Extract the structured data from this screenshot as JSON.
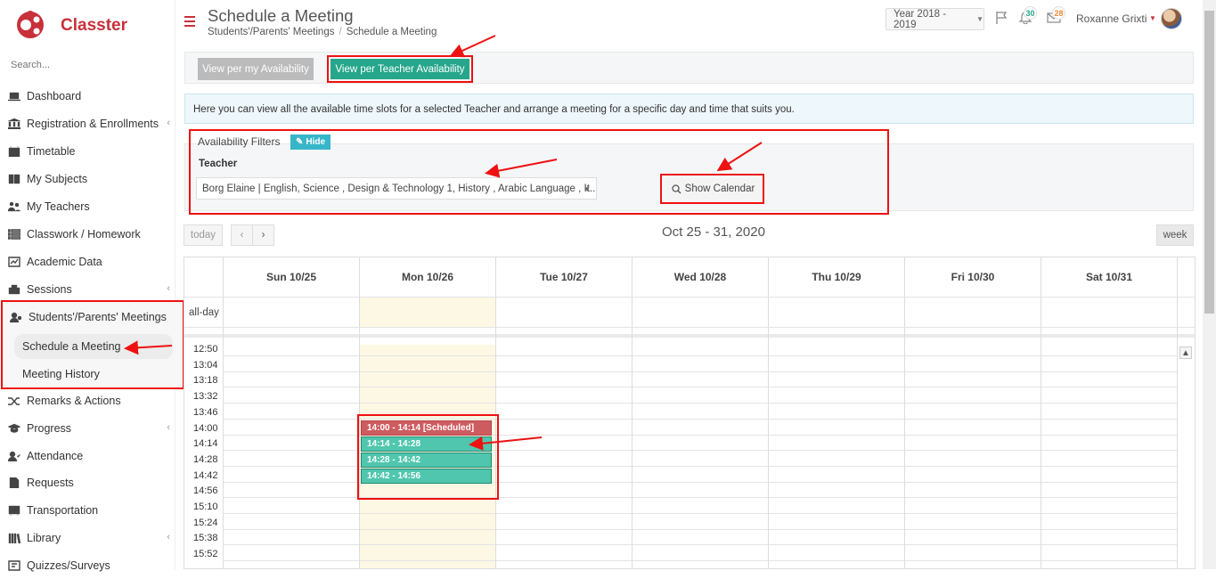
{
  "app": {
    "name": "Classter"
  },
  "sidebar": {
    "search_placeholder": "Search...",
    "items": [
      {
        "label": "Dashboard",
        "icon": "laptop-icon",
        "chev": ""
      },
      {
        "label": "Registration & Enrollments",
        "icon": "bank-icon",
        "chev": "‹"
      },
      {
        "label": "Timetable",
        "icon": "calendar-icon",
        "chev": ""
      },
      {
        "label": "My Subjects",
        "icon": "book-icon",
        "chev": ""
      },
      {
        "label": "My Teachers",
        "icon": "users-icon",
        "chev": ""
      },
      {
        "label": "Classwork / Homework",
        "icon": "list-icon",
        "chev": ""
      },
      {
        "label": "Academic Data",
        "icon": "chart-icon",
        "chev": ""
      },
      {
        "label": "Sessions",
        "icon": "sessions-icon",
        "chev": "‹"
      },
      {
        "label": "Students'/Parents' Meetings",
        "icon": "meeting-icon",
        "chev": "‹"
      },
      {
        "label": "Remarks & Actions",
        "icon": "shuffle-icon",
        "chev": ""
      },
      {
        "label": "Progress",
        "icon": "graduation-icon",
        "chev": "‹"
      },
      {
        "label": "Attendance",
        "icon": "user-check-icon",
        "chev": ""
      },
      {
        "label": "Requests",
        "icon": "document-icon",
        "chev": ""
      },
      {
        "label": "Transportation",
        "icon": "bus-icon",
        "chev": ""
      },
      {
        "label": "Library",
        "icon": "library-icon",
        "chev": "‹"
      },
      {
        "label": "Quizzes/Surveys",
        "icon": "quiz-icon",
        "chev": ""
      }
    ],
    "sub_items": [
      {
        "label": "Schedule a Meeting",
        "active": true
      },
      {
        "label": "Meeting History",
        "active": false
      }
    ]
  },
  "header": {
    "title": "Schedule a Meeting",
    "breadcrumb": [
      "Students'/Parents' Meetings",
      "Schedule a Meeting"
    ],
    "year": "Year 2018 - 2019",
    "notifications_count": "30",
    "messages_count": "28",
    "user_name": "Roxanne Grixti"
  },
  "tabs": {
    "by_my_availability": "View per my Availability",
    "by_teacher_availability": "View per Teacher Availability"
  },
  "info_text": "Here you can view all the available time slots for a selected Teacher and arrange a meeting for a specific day and time that suits you.",
  "filters": {
    "legend": "Availability Filters",
    "hide_label": "Hide",
    "teacher_label": "Teacher",
    "teacher_value": "Borg Elaine | English, Science , Design & Technology 1, History , Arabic Language , It...",
    "show_calendar_label": "Show Calendar"
  },
  "calendar": {
    "today_label": "today",
    "prev_label": "‹",
    "next_label": "›",
    "range": "Oct 25 - 31, 2020",
    "view_label": "week",
    "all_day_label": "all-day",
    "days": [
      "Sun 10/25",
      "Mon 10/26",
      "Tue 10/27",
      "Wed 10/28",
      "Thu 10/29",
      "Fri 10/30",
      "Sat 10/31"
    ],
    "times": [
      "12:50",
      "13:04",
      "13:18",
      "13:32",
      "13:46",
      "14:00",
      "14:14",
      "14:28",
      "14:42",
      "14:56",
      "15:10",
      "15:24",
      "15:38",
      "15:52"
    ],
    "events": [
      {
        "label": "14:00 - 14:14 [Scheduled]",
        "status": "scheduled",
        "day": "Mon 10/26"
      },
      {
        "label": "14:14 - 14:28",
        "status": "available",
        "day": "Mon 10/26"
      },
      {
        "label": "14:28 - 14:42",
        "status": "available",
        "day": "Mon 10/26"
      },
      {
        "label": "14:42 - 14:56",
        "status": "available",
        "day": "Mon 10/26"
      }
    ]
  },
  "colors": {
    "brand": "#c8303a",
    "accent": "#26a68b",
    "scheduled": "#cd5c61",
    "available": "#4fc6ad",
    "highlight": "#e11111"
  }
}
